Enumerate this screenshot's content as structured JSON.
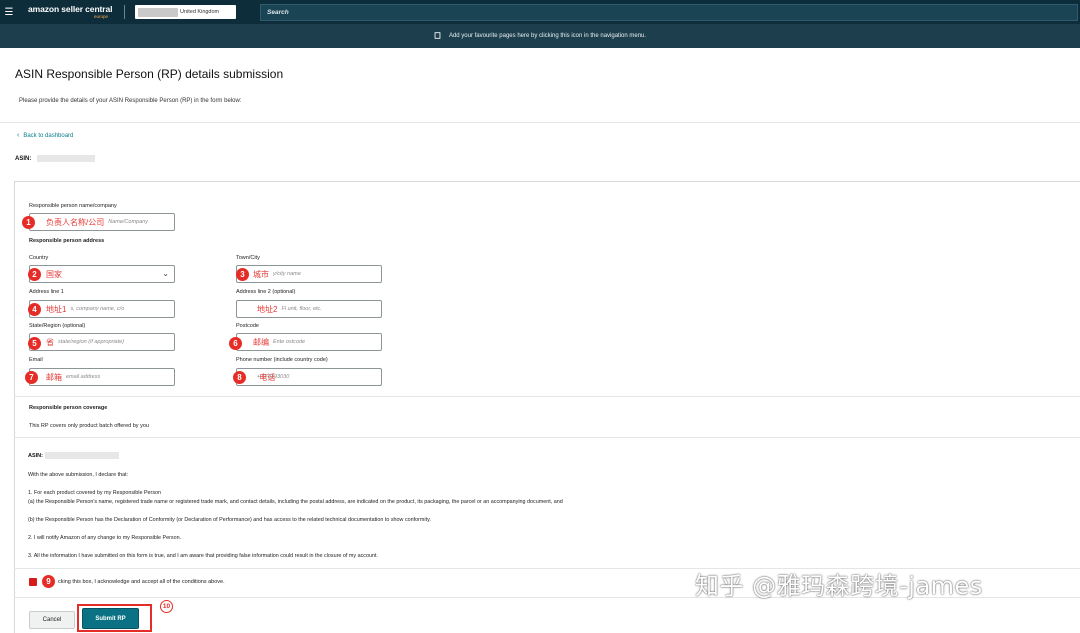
{
  "nav": {
    "menu_icon": "☰",
    "logo_main": "amazon seller central",
    "logo_sub": "europe",
    "marketplace": "United Kingdom",
    "search_placeholder": "Search"
  },
  "favbar": {
    "icon": "bookmark-icon",
    "text": "Add your favourite pages here by clicking this icon in the navigation menu."
  },
  "header": {
    "title": "ASIN Responsible Person (RP) details submission",
    "subtitle": "Please provide the details of your ASIN Responsible Person (RP) in the form below:",
    "back_link": "Back to dashboard",
    "back_chevron": "‹",
    "asin_label": "ASIN:"
  },
  "form": {
    "name_label": "Responsible person name/company",
    "name_placeholder": "Name/Company",
    "name_annotation": "负责人名称/公司",
    "address_heading": "Responsible person address",
    "country_label": "Country",
    "country_annotation": "国家",
    "country_chevron": "⌄",
    "town_label": "Town/City",
    "town_placeholder": "y/city name",
    "town_annotation": "城市",
    "address1_label": "Address line 1",
    "address1_placeholder": "s, company name, c/o",
    "address1_annotation": "地址1",
    "address2_label": "Address line 2 (optional)",
    "address2_placeholder": "Fl    unit, floor, etc.",
    "address2_annotation": "地址2",
    "state_label": "State/Region (optional)",
    "state_placeholder": "state/region (if appropriate)",
    "state_annotation": "省",
    "postcode_label": "Postcode",
    "postcode_placeholder": "Ente     ostcode",
    "postcode_annotation": "邮编",
    "email_label": "Email",
    "email_placeholder": "email address",
    "email_annotation": "邮箱",
    "phone_label": "Phone number (include country code)",
    "phone_placeholder": "+  678393030",
    "phone_annotation": "电话",
    "coverage_heading": "Responsible person coverage",
    "coverage_text": "This RP covers only product batch offered by you"
  },
  "declaration": {
    "asin_label": "ASIN:",
    "intro": "With the above submission, I declare that:",
    "item1_title": "1. For each product covered by my Responsible Person",
    "item1_a": "(a) the Responsible Person's name, registered trade name or registered trade mark, and contact details, including the postal address, are indicated on the product, its packaging, the parcel or an accompanying document, and",
    "item1_b": "(b) the Responsible Person has the Declaration of Conformity (or Declaration of Performance) and has access to the related technical documentation to show conformity.",
    "item2": "2. I will notify Amazon of any change to my Responsible Person.",
    "item3": "3. All the information I have submitted on this form is true, and I am aware that providing false information could result in the closure of my account.",
    "checkbox_text": "cking this box, I acknowledge and accept all of the conditions above."
  },
  "buttons": {
    "cancel": "Cancel",
    "submit": "Submit RP"
  },
  "badges": [
    "1",
    "2",
    "3",
    "4",
    "5",
    "6",
    "7",
    "8",
    "9",
    "10"
  ],
  "watermark": "知乎 @雅玛森跨境-james",
  "colors": {
    "nav_bg": "#0d2d3b",
    "favbar_bg": "#1d3f4d",
    "link": "#087f8c",
    "submit_bg": "#0b7285",
    "annotation_red": "#e52c27"
  }
}
